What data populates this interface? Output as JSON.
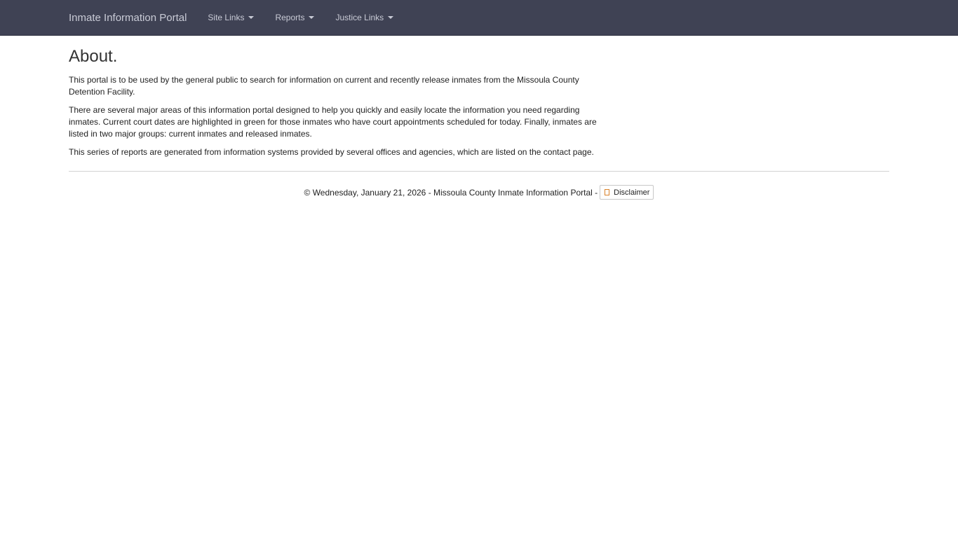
{
  "navbar": {
    "brand": "Inmate Information Portal",
    "menus": [
      {
        "label": "Site Links"
      },
      {
        "label": "Reports"
      },
      {
        "label": "Justice Links"
      }
    ]
  },
  "main": {
    "title": "About.",
    "paragraphs": [
      "This portal is to be used by the general public to search for information on current and recently release inmates from the Missoula County Detention Facility.",
      "There are several major areas of this information portal designed to help you quickly and easily locate the information you need regarding inmates. Current court dates are highlighted in green for those inmates who have court appointments scheduled for today. Finally, inmates are listed in two major groups: current inmates and released inmates.",
      "This series of reports are generated from information systems provided by several offices and agencies, which are listed on the contact page."
    ]
  },
  "footer": {
    "text": "© Wednesday, January 21, 2026 - Missoula County Inmate Information Portal -",
    "disclaimer_label": "Disclaimer",
    "disclaimer_icon": "document-icon"
  },
  "colors": {
    "navbar_bg": "#3f4254",
    "nav_text": "#c9cbd6",
    "icon_accent": "#d9822b"
  }
}
